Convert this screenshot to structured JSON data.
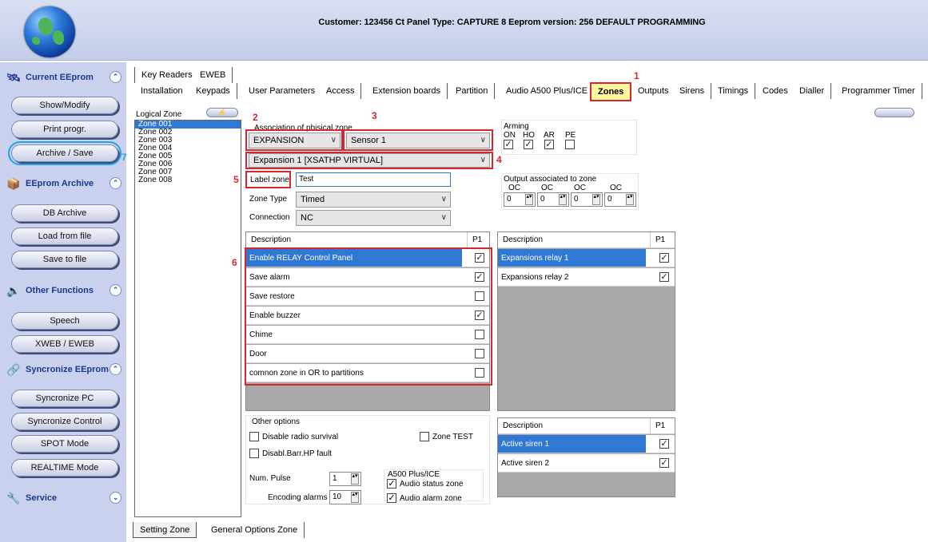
{
  "header": {
    "title": "Customer: 123456 Ct  Panel Type: CAPTURE 8  Eeprom version: 256  DEFAULT PROGRAMMING"
  },
  "sidebar": {
    "sections": [
      {
        "label": "Current EEprom",
        "icon": "current-eeprom-icon"
      },
      {
        "label": "EEprom Archive",
        "icon": "archive-icon"
      },
      {
        "label": "Other Functions",
        "icon": "speaker-icon"
      },
      {
        "label": "Syncronize EEprom",
        "icon": "sync-icon"
      },
      {
        "label": "Service",
        "icon": "service-icon"
      }
    ],
    "buttons": [
      "Show/Modify",
      "Print progr.",
      "Archive / Save",
      "DB Archive",
      "Load from file",
      "Save to file",
      "Speech",
      "XWEB / EWEB",
      "Syncronize PC",
      "Syncronize Control",
      "SPOT Mode",
      "REALTIME Mode"
    ]
  },
  "tabs_top": [
    "Key Readers",
    "EWEB"
  ],
  "tabs": [
    "Installation",
    "Keypads",
    "User Parameters",
    "Access",
    "Extension boards",
    "Partition",
    "Audio A500 Plus/ICE",
    "Zones",
    "Outputs",
    "Sirens",
    "Timings",
    "Codes",
    "Dialler",
    "Programmer Timer"
  ],
  "logical_zone": {
    "label": "Logical Zone",
    "zones": [
      "Zone 001",
      "Zone 002",
      "Zone 003",
      "Zone 004",
      "Zone 005",
      "Zone 006",
      "Zone 007",
      "Zone 008"
    ]
  },
  "assoc": {
    "label": "Association of phisical zone",
    "type": "EXPANSION",
    "sensor": "Sensor 1",
    "expansion": "Expansion 1 [XSATHP VIRTUAL]"
  },
  "label_zone": {
    "label": "Label zone",
    "value": "Test"
  },
  "zone_type": {
    "label": "Zone Type",
    "value": "Timed"
  },
  "connection": {
    "label": "Connection",
    "value": "NC"
  },
  "arming": {
    "label": "Arming",
    "cols": [
      "ON",
      "HO",
      "AR",
      "PE"
    ],
    "checked": [
      true,
      true,
      true,
      false
    ]
  },
  "output_assoc": {
    "label": "Output associated to zone",
    "cols": [
      "OC",
      "OC",
      "OC",
      "OC"
    ],
    "values": [
      "0",
      "0",
      "0",
      "0"
    ]
  },
  "desc_table": {
    "col1": "Description",
    "col2": "P1",
    "rows": [
      {
        "label": "Enable RELAY Control Panel",
        "checked": true
      },
      {
        "label": "Save alarm",
        "checked": true
      },
      {
        "label": "Save restore",
        "checked": false
      },
      {
        "label": "Enable buzzer",
        "checked": true
      },
      {
        "label": "Chime",
        "checked": false
      },
      {
        "label": "Door",
        "checked": false
      },
      {
        "label": "comnon zone in OR to partitions",
        "checked": false
      }
    ]
  },
  "relay_table": {
    "col1": "Description",
    "col2": "P1",
    "rows": [
      {
        "label": "Expansions relay 1",
        "checked": true
      },
      {
        "label": "Expansions relay 2",
        "checked": true
      }
    ]
  },
  "siren_table": {
    "col1": "Description",
    "col2": "P1",
    "rows": [
      {
        "label": "Active siren 1",
        "checked": true
      },
      {
        "label": "Active siren 2",
        "checked": true
      }
    ]
  },
  "other_options": {
    "label": "Other options",
    "disable_radio": "Disable radio survival",
    "zone_test": "Zone TEST",
    "disabl_barr": "Disabl.Barr.HP fault",
    "num_pulse_label": "Num. Pulse",
    "num_pulse": "1",
    "encoding_label": "Encoding alarms",
    "encoding": "10"
  },
  "a500": {
    "label": "A500 Plus/ICE",
    "status": "Audio status zone",
    "alarm": "Audio alarm zone"
  },
  "bottom_tabs": [
    "Setting Zone",
    "General Options Zone"
  ],
  "callouts": [
    "1",
    "2",
    "3",
    "4",
    "5",
    "6",
    "7"
  ],
  "colors": {
    "accent": "#2f78d3",
    "callout": "#d8262e",
    "highlight": "#23a3e8"
  }
}
